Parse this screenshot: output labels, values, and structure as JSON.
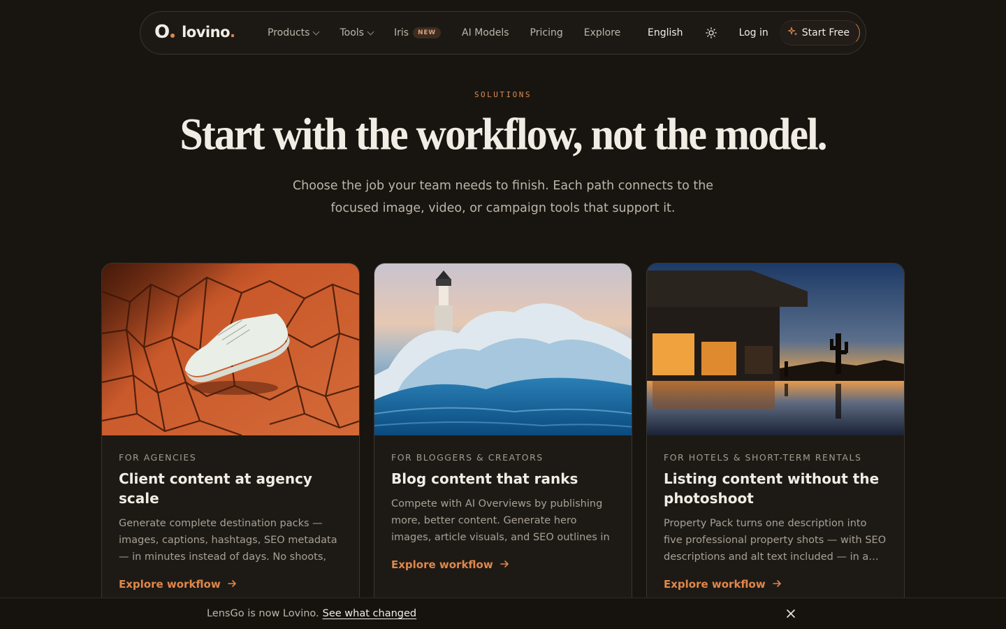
{
  "nav": {
    "logo_mark": "O",
    "logo_text": "lovino",
    "logo_dot": ".",
    "links": [
      {
        "label": "Products",
        "dropdown": true
      },
      {
        "label": "Tools",
        "dropdown": true
      },
      {
        "label": "Iris",
        "badge": "NEW"
      },
      {
        "label": "AI Models"
      },
      {
        "label": "Pricing"
      },
      {
        "label": "Explore"
      }
    ],
    "language": "English",
    "login": "Log in",
    "start": "Start Free"
  },
  "hero": {
    "eyebrow": "SOLUTIONS",
    "headline": "Start with the workflow, not the model.",
    "subtitle": "Choose the job your team needs to finish. Each path connects to the focused image, video, or campaign tools that support it."
  },
  "cards": [
    {
      "eyebrow": "FOR AGENCIES",
      "title": "Client content at agency scale",
      "desc": "Generate complete destination packs — images, captions, hashtags, SEO metadata — in minutes instead of days. No shoots, no…",
      "link": "Explore workflow"
    },
    {
      "eyebrow": "FOR BLOGGERS & CREATORS",
      "title": "Blog content that ranks",
      "desc": "Compete with AI Overviews by publishing more, better content. Generate hero images, article visuals, and SEO outlines in minutes…",
      "link": "Explore workflow"
    },
    {
      "eyebrow": "FOR HOTELS & SHORT-TERM RENTALS",
      "title": "Listing content without the photoshoot",
      "desc": "Property Pack turns one description into five professional property shots — with SEO descriptions and alt text included — in a…",
      "link": "Explore workflow"
    }
  ],
  "banner": {
    "text": "LensGo is now Lovino.",
    "link": "See what changed"
  },
  "colors": {
    "background": "#181511",
    "accent": "#e0874a",
    "text": "#ece6dc",
    "muted": "#a8a094"
  }
}
